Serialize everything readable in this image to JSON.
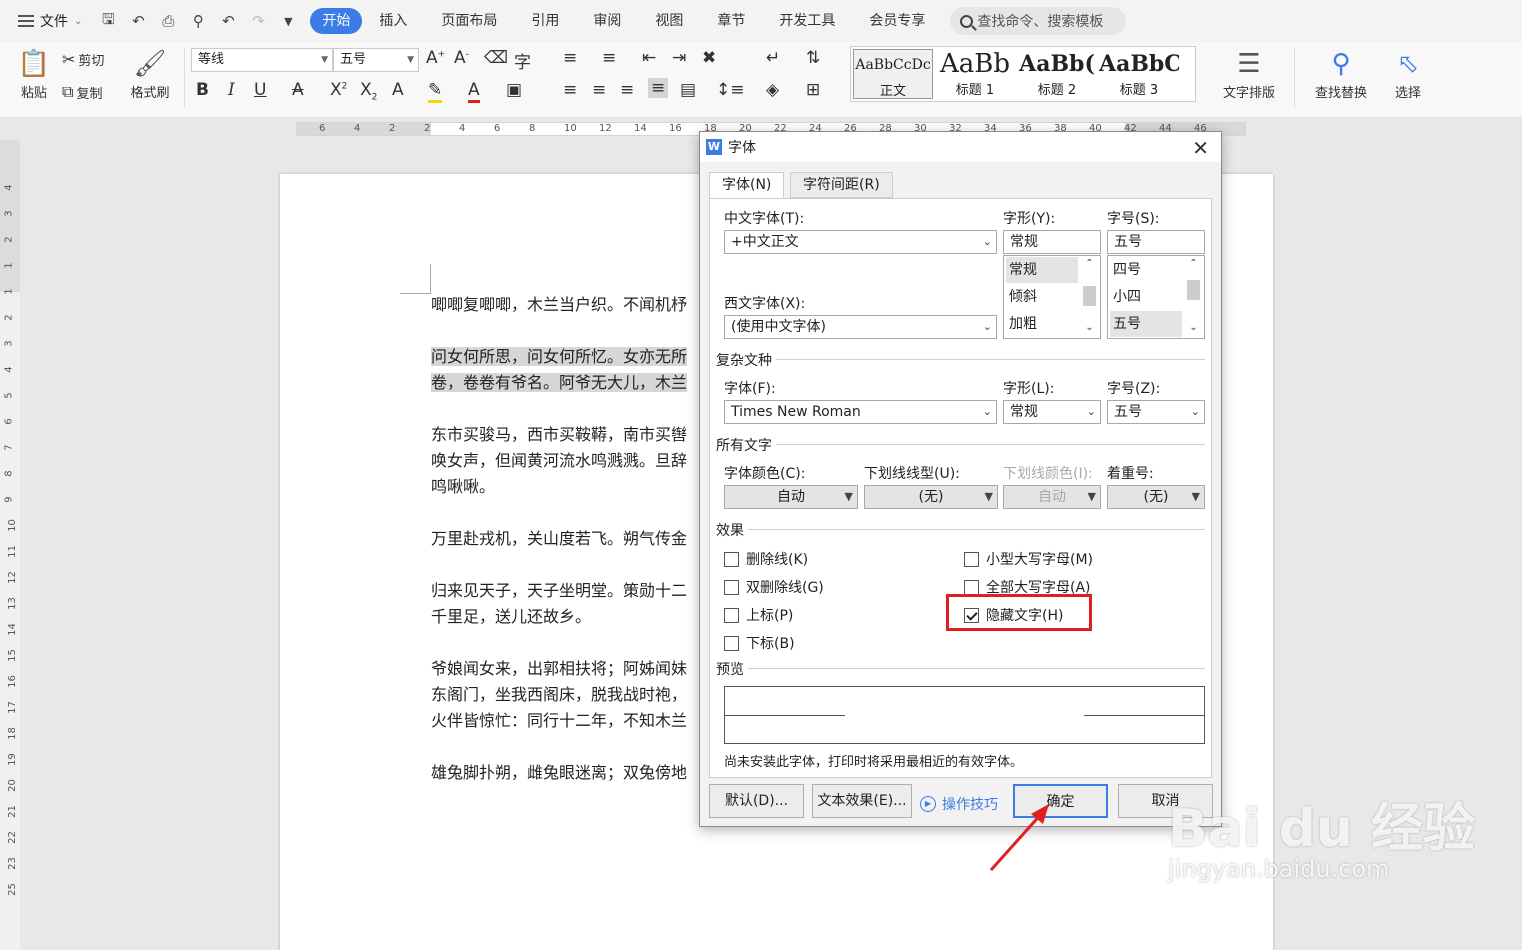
{
  "menubar": {
    "file_label": "文件",
    "tabs": [
      "开始",
      "插入",
      "页面布局",
      "引用",
      "审阅",
      "视图",
      "章节",
      "开发工具",
      "会员专享"
    ],
    "active_tab": "开始",
    "search_placeholder": "查找命令、搜索模板"
  },
  "ribbon": {
    "paste": "粘贴",
    "cut": "剪切",
    "copy": "复制",
    "format_painter": "格式刷",
    "font_name": "等线",
    "font_size": "五号",
    "styles": [
      {
        "sample": "AaBbCcDc",
        "name": "正文"
      },
      {
        "sample": "AaBb",
        "name": "标题 1"
      },
      {
        "sample": "AaBb(",
        "name": "标题 2"
      },
      {
        "sample": "AaBbC",
        "name": "标题 3"
      }
    ],
    "text_layout": "文字排版",
    "find_replace": "查找替换",
    "select": "选择"
  },
  "ruler": {
    "h_marks": [
      "6",
      "4",
      "2",
      "2",
      "4",
      "6",
      "8",
      "10",
      "12",
      "14",
      "16",
      "18",
      "20",
      "22",
      "24",
      "26",
      "28",
      "30",
      "32",
      "34",
      "36",
      "38",
      "40",
      "42",
      "44",
      "46"
    ],
    "v_marks": [
      "4",
      "3",
      "2",
      "1",
      "1",
      "2",
      "3",
      "4",
      "5",
      "6",
      "7",
      "8",
      "9",
      "10",
      "11",
      "12",
      "13",
      "14",
      "15",
      "16",
      "17",
      "18",
      "19",
      "20",
      "21",
      "22",
      "23",
      "25"
    ]
  },
  "document": {
    "paragraphs": [
      {
        "lines": [
          "唧唧复唧唧，木兰当户织。不闻机杼"
        ],
        "highlight": false
      },
      {
        "lines": [
          "问女何所思，问女何所忆。女亦无所",
          "卷，卷卷有爷名。阿爷无大儿，木兰"
        ],
        "highlight": true
      },
      {
        "lines": [
          "东市买骏马，西市买鞍鞯，南市买辔",
          "唤女声，但闻黄河流水鸣溅溅。旦辞",
          "鸣啾啾。"
        ],
        "highlight": false
      },
      {
        "lines": [
          "万里赴戎机，关山度若飞。朔气传金"
        ],
        "highlight": false
      },
      {
        "lines": [
          "归来见天子，天子坐明堂。策勋十二",
          "千里足，送儿还故乡。"
        ],
        "highlight": false
      },
      {
        "lines": [
          "爷娘闻女来，出郭相扶将；阿姊闻妹",
          "东阁门，坐我西阁床，脱我战时袍，",
          "火伴皆惊忙：同行十二年，不知木兰"
        ],
        "highlight": false
      },
      {
        "lines": [
          "雄兔脚扑朔，雌兔眼迷离；双兔傍地"
        ],
        "highlight": false
      }
    ]
  },
  "dialog": {
    "title": "字体",
    "tabs": [
      "字体(N)",
      "字符间距(R)"
    ],
    "cn_font_label": "中文字体(T):",
    "cn_font_value": "+中文正文",
    "style_label": "字形(Y):",
    "style_value": "常规",
    "style_options": [
      "常规",
      "倾斜",
      "加粗"
    ],
    "size_label": "字号(S):",
    "size_value": "五号",
    "size_options": [
      "四号",
      "小四",
      "五号"
    ],
    "west_font_label": "西文字体(X):",
    "west_font_value": "(使用中文字体)",
    "complex_group": "复杂文种",
    "complex_font_label": "字体(F):",
    "complex_font_value": "Times New Roman",
    "complex_style_label": "字形(L):",
    "complex_style_value": "常规",
    "complex_size_label": "字号(Z):",
    "complex_size_value": "五号",
    "all_text_group": "所有文字",
    "color_label": "字体颜色(C):",
    "color_value": "自动",
    "underline_label": "下划线线型(U):",
    "underline_value": "(无)",
    "underline_color_label": "下划线颜色(I):",
    "underline_color_value": "自动",
    "emphasis_label": "着重号:",
    "emphasis_value": "(无)",
    "effects_group": "效果",
    "effects_left": [
      {
        "label": "删除线(K)",
        "checked": false
      },
      {
        "label": "双删除线(G)",
        "checked": false
      },
      {
        "label": "上标(P)",
        "checked": false
      },
      {
        "label": "下标(B)",
        "checked": false
      }
    ],
    "effects_right": [
      {
        "label": "小型大写字母(M)",
        "checked": false
      },
      {
        "label": "全部大写字母(A)",
        "checked": false
      },
      {
        "label": "隐藏文字(H)",
        "checked": true
      }
    ],
    "preview_group": "预览",
    "note": "尚未安装此字体，打印时将采用最相近的有效字体。",
    "btn_default": "默认(D)...",
    "btn_text_effect": "文本效果(E)...",
    "tips": "操作技巧",
    "btn_ok": "确定",
    "btn_cancel": "取消"
  },
  "watermark": {
    "brand": "Bai du 经验",
    "url": "jingyan.baidu.com"
  },
  "colors": {
    "accent": "#3c7ce7",
    "highlight_box": "#e02020"
  }
}
